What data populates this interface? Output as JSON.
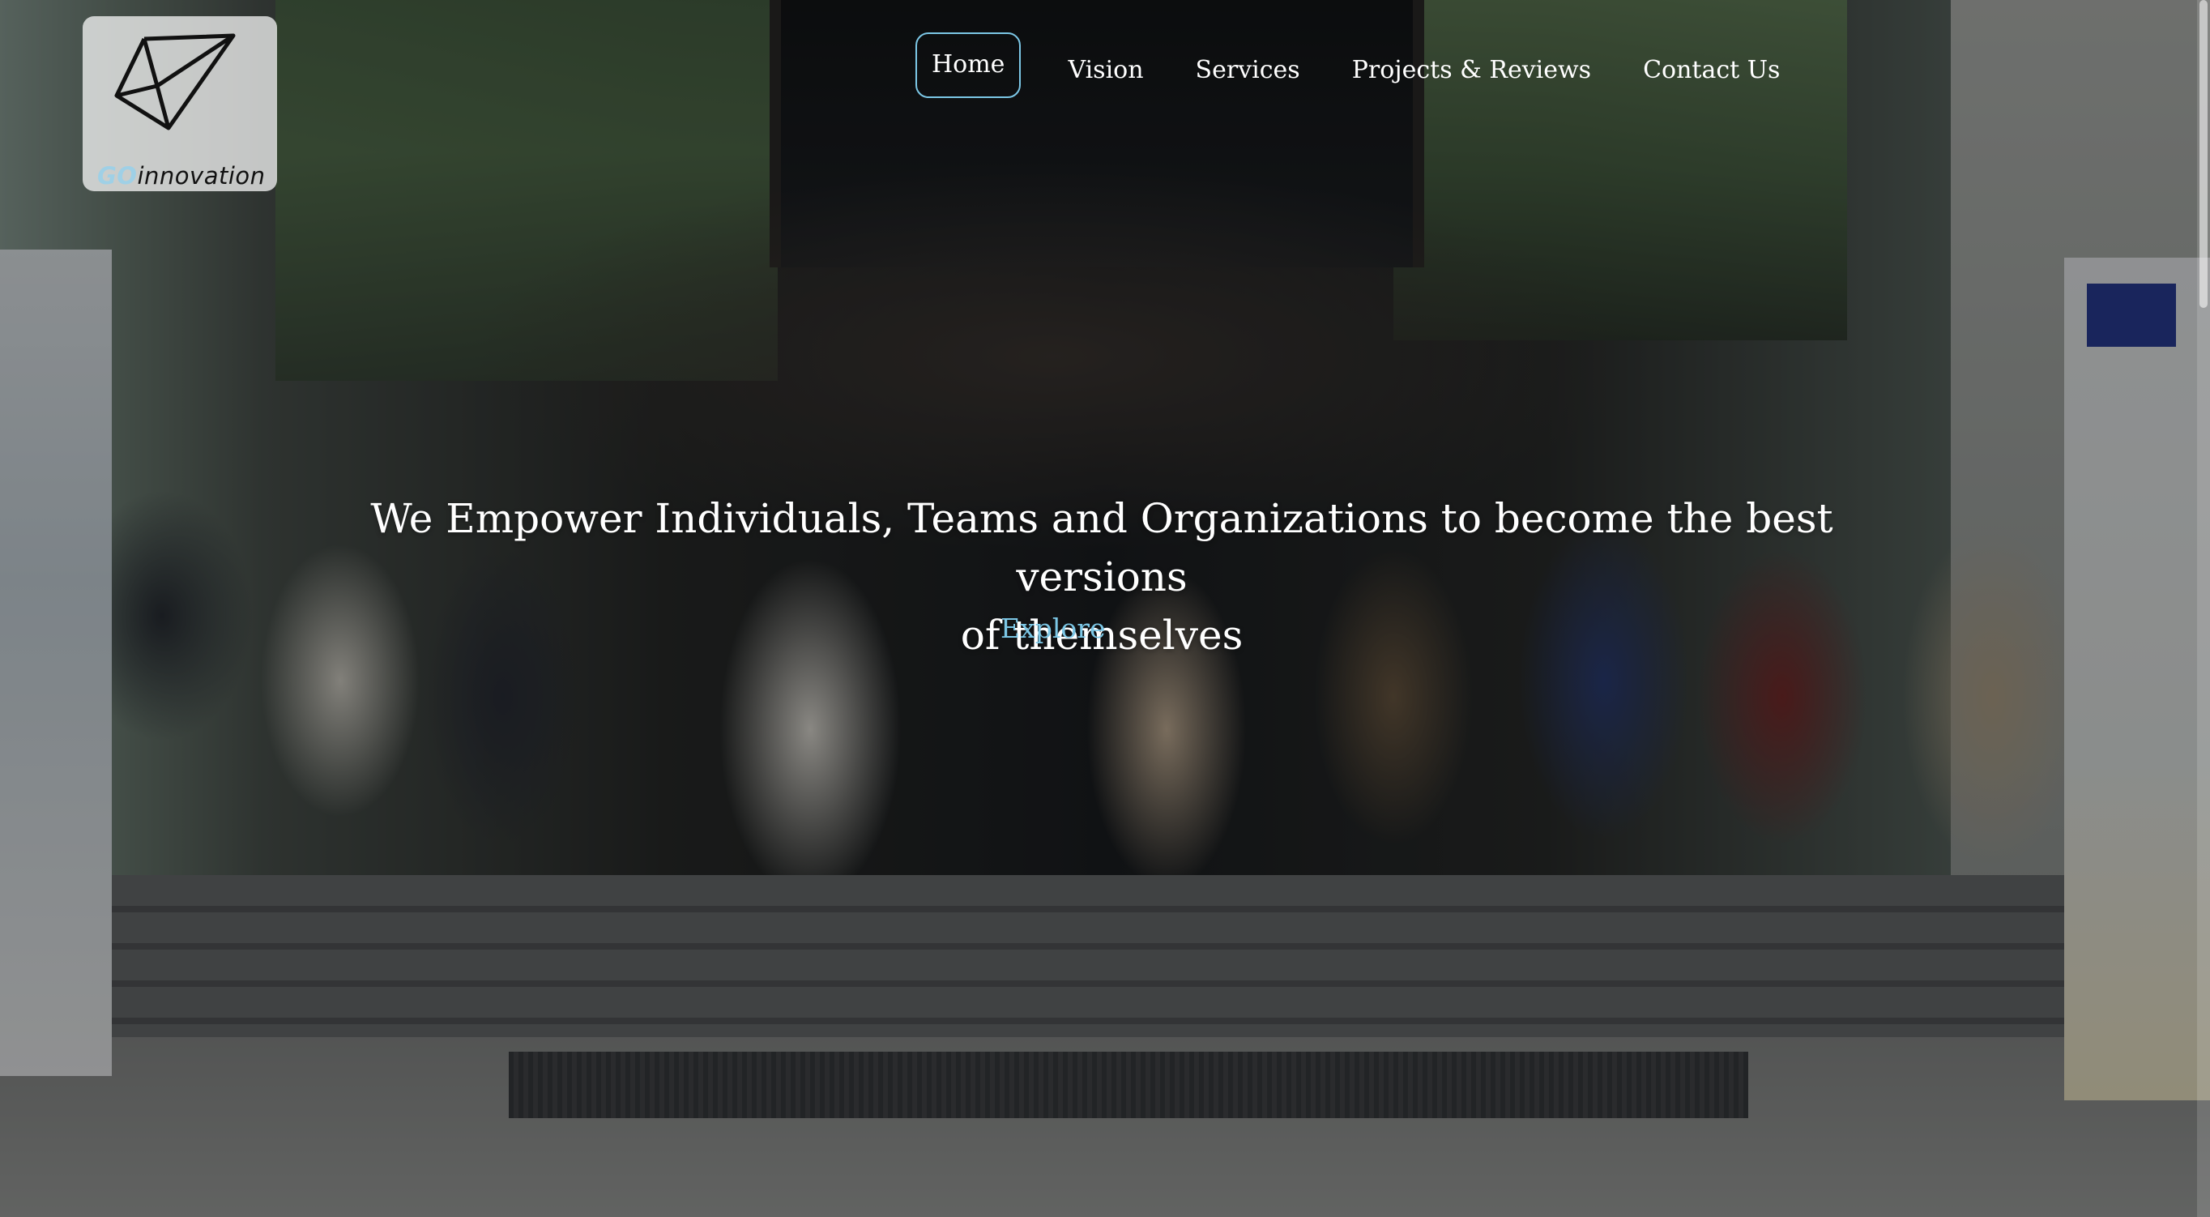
{
  "logo": {
    "go": "GO",
    "rest": "innovation",
    "icon": "polygon-logo-icon"
  },
  "nav": {
    "items": [
      {
        "label": "Home",
        "active": true
      },
      {
        "label": "Vision",
        "active": false
      },
      {
        "label": "Services",
        "active": false
      },
      {
        "label": "Projects & Reviews",
        "active": false
      },
      {
        "label": "Contact Us",
        "active": false
      }
    ]
  },
  "hero": {
    "headline_line1": "We Empower Individuals, Teams and Organizations to become the best versions",
    "headline_line2": "of themselves",
    "explore_label": "Explore"
  },
  "colors": {
    "accent": "#7cc7e6",
    "text": "#ffffff"
  }
}
